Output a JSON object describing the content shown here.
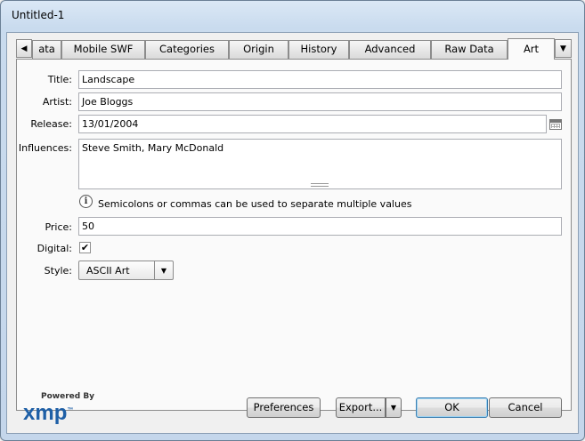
{
  "window": {
    "title": "Untitled-1"
  },
  "tabs": [
    {
      "label": "ata"
    },
    {
      "label": "Mobile SWF"
    },
    {
      "label": "Categories"
    },
    {
      "label": "Origin"
    },
    {
      "label": "History"
    },
    {
      "label": "Advanced"
    },
    {
      "label": "Raw Data"
    },
    {
      "label": "Art",
      "active": true
    }
  ],
  "tab_scroll": {
    "left_icon": "triangle-left-icon",
    "right_icon": "triangle-down-icon"
  },
  "form": {
    "title": {
      "label": "Title:",
      "value": "Landscape"
    },
    "artist": {
      "label": "Artist:",
      "value": "Joe Bloggs"
    },
    "release": {
      "label": "Release:",
      "value": "13/01/2004",
      "icon": "calendar-icon"
    },
    "influences": {
      "label": "Influences:",
      "value": "Steve Smith, Mary McDonald"
    },
    "hint": {
      "icon": "info-icon",
      "glyph": "i",
      "text": "Semicolons or commas can be used to separate multiple values"
    },
    "price": {
      "label": "Price:",
      "value": "50"
    },
    "digital": {
      "label": "Digital:",
      "checked": true,
      "check_glyph": "✔"
    },
    "style": {
      "label": "Style:",
      "value": "ASCII Art"
    }
  },
  "footer": {
    "logo_powered": "Powered By",
    "logo_brand": "xmp",
    "logo_tm": "™",
    "preferences_label": "Preferences",
    "export_label": "Export...",
    "ok_label": "OK",
    "cancel_label": "Cancel"
  }
}
